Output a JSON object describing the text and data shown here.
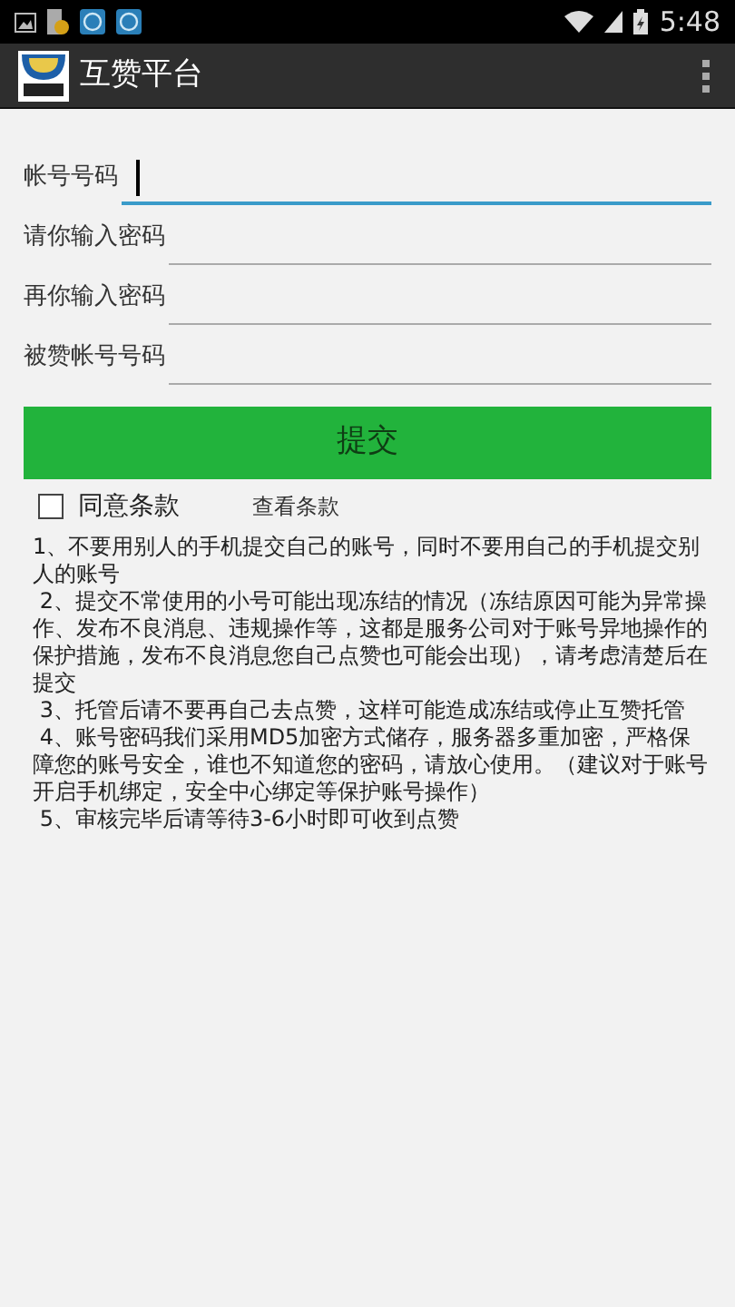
{
  "status_bar": {
    "time": "5:48"
  },
  "app_bar": {
    "title": "互赞平台"
  },
  "fields": [
    {
      "label": "帐号号码",
      "focused": true
    },
    {
      "label": "请你输入密码",
      "focused": false
    },
    {
      "label": "再你输入密码",
      "focused": false
    },
    {
      "label": "被赞帐号号码",
      "focused": false
    }
  ],
  "submit_button": "提交",
  "agree": {
    "label": "同意条款",
    "checked": false
  },
  "terms_link": "查看条款",
  "notes": [
    "1、不要用别人的手机提交自己的账号，同时不要用自己的手机提交别人的账号",
    " 2、提交不常使用的小号可能出现冻结的情况（冻结原因可能为异常操作、发布不良消息、违规操作等，这都是服务公司对于账号异地操作的保护措施，发布不良消息您自己点赞也可能会出现），请考虑清楚后在提交",
    " 3、托管后请不要再自己去点赞，这样可能造成冻结或停止互赞托管",
    " 4、账号密码我们采用MD5加密方式储存，服务器多重加密，严格保障您的账号安全，谁也不知道您的密码，请放心使用。（建议对于账号开启手机绑定，安全中心绑定等保护账号操作）",
    " 5、审核完毕后请等待3-6小时即可收到点赞"
  ]
}
